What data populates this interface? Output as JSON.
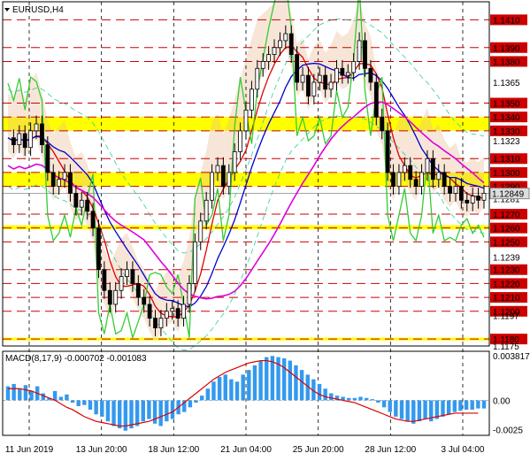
{
  "symbol_label": "EURUSD,H4",
  "macd_label": "MACD(8,17,9) -0.000702 -0.001083",
  "chart_data": {
    "type": "candlestick",
    "symbol": "EURUSD",
    "timeframe": "H4",
    "ylim": [
      1.1175,
      1.1423
    ],
    "y_tick_labels": [
      "1.1365",
      "1.1323",
      "1.1281",
      "1.1239",
      "1.1197",
      "1.1175"
    ],
    "key_levels": [
      "1.1410",
      "1.1390",
      "1.1380",
      "1.1350",
      "1.1340",
      "1.1330",
      "1.1310",
      "1.1300",
      "1.1290",
      "1.1270",
      "1.1260",
      "1.1250",
      "1.1230",
      "1.1220",
      "1.1210",
      "1.1200",
      "1.1180"
    ],
    "highlighted_levels": [
      "1.1340",
      "1.1330",
      "1.1300",
      "1.1290",
      "1.1260",
      "1.1180"
    ],
    "current_price": "1.12849",
    "support_zones": [
      [
        1.133,
        1.134
      ],
      [
        1.129,
        1.13
      ],
      [
        1.1259,
        1.1262
      ],
      [
        1.1179,
        1.1181
      ]
    ],
    "x_tick_labels": [
      "11 Jun 2019",
      "13 Jun 20:00",
      "18 Jun 12:00",
      "21 Jun 04:00",
      "25 Jun 20:00",
      "28 Jun 12:00",
      "3 Jul 04:00"
    ],
    "close_path": [
      1.1325,
      1.132,
      1.1328,
      1.1318,
      1.133,
      1.1335,
      1.132,
      1.13,
      1.129,
      1.1295,
      1.13,
      1.1285,
      1.1275,
      1.128,
      1.1272,
      1.126,
      1.123,
      1.1215,
      1.1205,
      1.1215,
      1.1225,
      1.123,
      1.122,
      1.121,
      1.1205,
      1.1195,
      1.1188,
      1.1195,
      1.12,
      1.1202,
      1.1195,
      1.1205,
      1.122,
      1.125,
      1.1265,
      1.128,
      1.13,
      1.1305,
      1.129,
      1.13,
      1.1315,
      1.133,
      1.1345,
      1.136,
      1.1375,
      1.138,
      1.1385,
      1.139,
      1.1395,
      1.14,
      1.1385,
      1.1365,
      1.137,
      1.1355,
      1.1365,
      1.137,
      1.136,
      1.1365,
      1.1375,
      1.137,
      1.1372,
      1.138,
      1.1395,
      1.1375,
      1.1365,
      1.134,
      1.133,
      1.13,
      1.129,
      1.13,
      1.1305,
      1.1295,
      1.129,
      1.13,
      1.131,
      1.1295,
      1.13,
      1.129,
      1.1285,
      1.129,
      1.128,
      1.1278,
      1.1283,
      1.128,
      1.1285
    ],
    "macd": {
      "label": "MACD(8,17,9)",
      "main": -0.000702,
      "signal": -0.001083,
      "y_tick_labels": [
        "0.003817",
        "0.00",
        "-0.0025"
      ],
      "ylim": [
        -0.003,
        0.0042
      ],
      "hist": [
        0.0012,
        0.0014,
        0.001,
        0.0013,
        0.0008,
        0.0012,
        0.0006,
        0.0002,
        0.0008,
        0.0003,
        0.0005,
        -0.0002,
        -0.0005,
        -0.0004,
        -0.0008,
        -0.0012,
        -0.0014,
        -0.0018,
        -0.0022,
        -0.0024,
        -0.0026,
        -0.0024,
        -0.0022,
        -0.0018,
        -0.0016,
        -0.002,
        -0.0022,
        -0.0018,
        -0.0016,
        -0.0012,
        -0.001,
        -0.0006,
        -0.0002,
        0.0004,
        0.001,
        0.0016,
        0.002,
        0.0022,
        0.0018,
        0.0016,
        0.0022,
        0.0026,
        0.003,
        0.0034,
        0.0037,
        0.0038,
        0.0037,
        0.0036,
        0.0034,
        0.003,
        0.0026,
        0.0022,
        0.0018,
        0.0014,
        0.001,
        0.0006,
        0.0004,
        0.0003,
        0.0002,
        0.0002,
        0.0003,
        0.0002,
        0.0001,
        -0.0002,
        -0.0006,
        -0.001,
        -0.0014,
        -0.0016,
        -0.0018,
        -0.002,
        -0.0018,
        -0.0016,
        -0.0018,
        -0.0016,
        -0.0014,
        -0.0012,
        -0.001,
        -0.0009,
        -0.0008,
        -0.0008,
        -0.0007,
        -0.0007
      ],
      "signal_path": [
        0.001,
        0.001,
        0.001,
        0.0009,
        0.0008,
        0.0006,
        0.0004,
        0.0002,
        0.0,
        -0.0003,
        -0.0006,
        -0.0008,
        -0.0011,
        -0.0014,
        -0.0016,
        -0.0018,
        -0.0019,
        -0.002,
        -0.0021,
        -0.0022,
        -0.0022,
        -0.0021,
        -0.002,
        -0.0019,
        -0.0018,
        -0.0016,
        -0.0014,
        -0.0012,
        -0.001,
        -0.0006,
        -0.0002,
        0.0002,
        0.0006,
        0.001,
        0.0014,
        0.0018,
        0.0021,
        0.0024,
        0.0026,
        0.0028,
        0.003,
        0.0032,
        0.0033,
        0.0034,
        0.0034,
        0.0033,
        0.0031,
        0.0028,
        0.0024,
        0.002,
        0.0016,
        0.0012,
        0.0008,
        0.0005,
        0.0003,
        0.0002,
        0.0001,
        0.0,
        -0.0001,
        -0.0002,
        -0.0004,
        -0.0006,
        -0.0008,
        -0.001,
        -0.0012,
        -0.0014,
        -0.0016,
        -0.0017,
        -0.0018,
        -0.0018,
        -0.0017,
        -0.0016,
        -0.0015,
        -0.0014,
        -0.0013,
        -0.0012,
        -0.0011,
        -0.0011,
        -0.0011,
        -0.0011,
        -0.0011
      ]
    }
  },
  "colors": {
    "level_line": "#cc0000",
    "zone_fill": "#ffff00",
    "candle": "#000000",
    "green_line": "#33cc33",
    "red_line": "#dd0000",
    "blue_line": "#0000cc",
    "magenta_line": "#dd00dd",
    "cloud": "#e8b890",
    "envelope": "#33cc99",
    "macd_hist": "#3399ee",
    "macd_signal": "#dd0000",
    "price_tag": "#dddddd"
  }
}
